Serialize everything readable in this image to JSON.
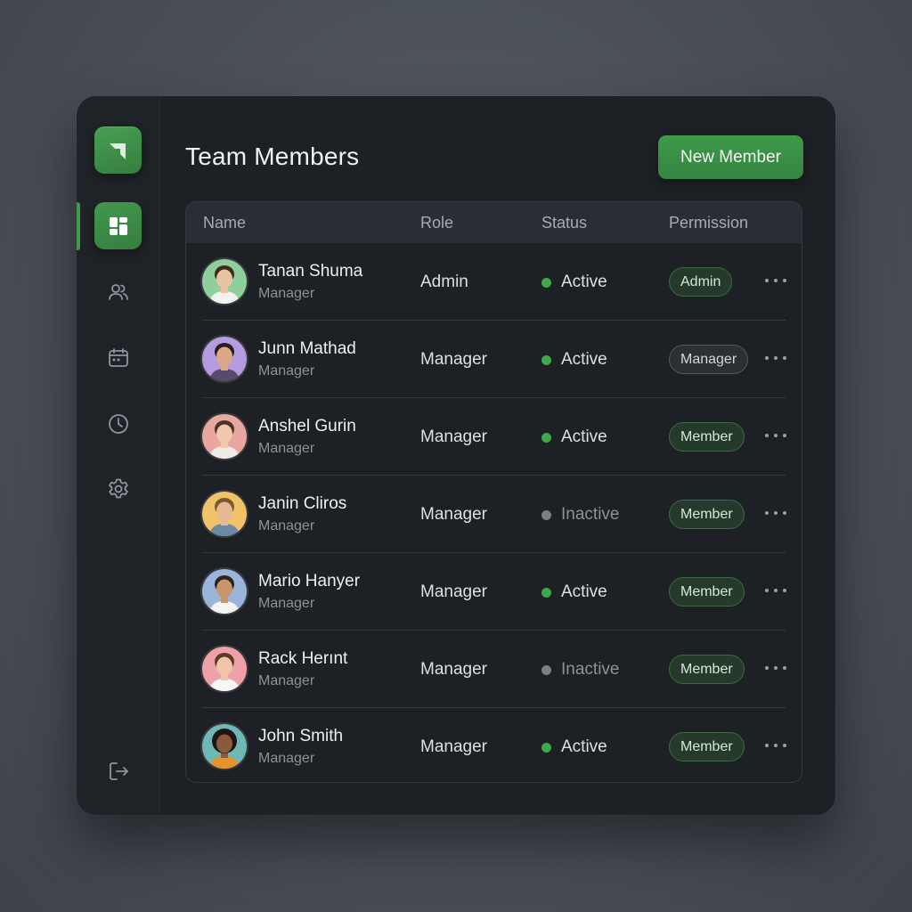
{
  "page": {
    "title": "Team Members",
    "new_button": "New Member"
  },
  "table": {
    "headers": {
      "name": "Name",
      "role": "Role",
      "status": "Status",
      "permission": "Permission"
    },
    "rows": [
      {
        "name": "Tanan Shuma",
        "subtitle": "Manager",
        "role": "Admin",
        "status": "Active",
        "permission": "Admin",
        "badge_style": "green",
        "avatar_bg": "#8fcf9c"
      },
      {
        "name": "Junn Mathad",
        "subtitle": "Manager",
        "role": "Manager",
        "status": "Active",
        "permission": "Manager",
        "badge_style": "gray",
        "avatar_bg": "#b59be0"
      },
      {
        "name": "Anshel Gurin",
        "subtitle": "Manager",
        "role": "Manager",
        "status": "Active",
        "permission": "Member",
        "badge_style": "green",
        "avatar_bg": "#e8a8a0"
      },
      {
        "name": "Janin Cliros",
        "subtitle": "Manager",
        "role": "Manager",
        "status": "Inactive",
        "permission": "Member",
        "badge_style": "green",
        "avatar_bg": "#f2c26a"
      },
      {
        "name": "Mario Hanyer",
        "subtitle": "Manager",
        "role": "Manager",
        "status": "Active",
        "permission": "Member",
        "badge_style": "green",
        "avatar_bg": "#9ab4dc"
      },
      {
        "name": "Rack Herınt",
        "subtitle": "Manager",
        "role": "Manager",
        "status": "Inactive",
        "permission": "Member",
        "badge_style": "green",
        "avatar_bg": "#f0a0a8"
      },
      {
        "name": "John Smith",
        "subtitle": "Manager",
        "role": "Manager",
        "status": "Active",
        "permission": "Member",
        "badge_style": "green",
        "avatar_bg": "#6fb8b8"
      }
    ]
  },
  "sidebar": {
    "items": [
      {
        "icon": "dashboard-icon",
        "active": true
      },
      {
        "icon": "users-icon",
        "active": false
      },
      {
        "icon": "calendar-icon",
        "active": false
      },
      {
        "icon": "clock-icon",
        "active": false
      },
      {
        "icon": "gear-icon",
        "active": false
      },
      {
        "icon": "logout-icon",
        "active": false
      }
    ]
  },
  "colors": {
    "accent": "#3f9a4a",
    "active_dot": "#3ea84b",
    "inactive_dot": "#7b7f85",
    "window_bg": "#1d2024"
  }
}
